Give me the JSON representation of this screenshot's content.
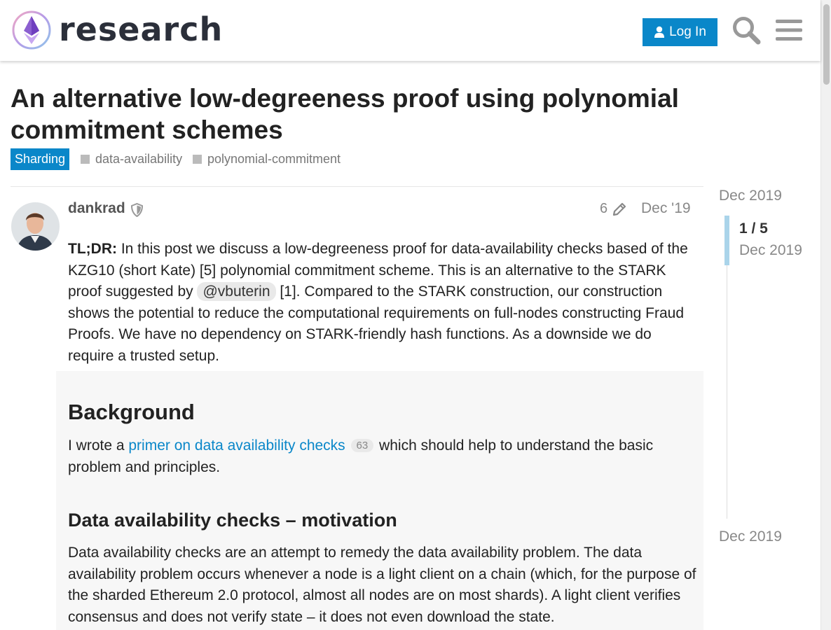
{
  "header": {
    "logo_text": "research",
    "login_label": "Log In",
    "search_icon": "search-icon",
    "menu_icon": "hamburger-menu-icon"
  },
  "topic": {
    "title": "An alternative low-degreeness proof using polynomial commitment schemes",
    "category": "Sharding",
    "tags": [
      "data-availability",
      "polynomial-commitment"
    ]
  },
  "post": {
    "username": "dankrad",
    "edit_count": "6",
    "date": "Dec '19",
    "p1": {
      "lead": "TL;DR:",
      "text_a": " In this post we discuss a low-degreeness proof for data-availability checks based of the KZG10 (short Kate) [5] polynomial commitment scheme. This is an alternative to the STARK proof suggested by ",
      "mention": "@vbuterin",
      "text_b": " [1]. Compared to the STARK construction, our construction shows the potential to reduce the computational requirements on full-nodes constructing Fraud Proofs. We have no dependency on STARK-friendly hash functions. As a downside we do require a trusted setup."
    },
    "h_background": "Background",
    "p2": {
      "text_a": "I wrote a ",
      "link": "primer on data availability checks",
      "clicks": "63",
      "text_b": " which should help to understand the basic problem and principles."
    },
    "h_motivation": "Data availability checks – motivation",
    "p3": "Data availability checks are an attempt to remedy the data availability problem. The data availability problem occurs whenever a node is a light client on a chain (which, for the purpose of the sharded Ethereum 2.0 protocol, almost all nodes are on most shards). A light client verifies consensus and does not verify state – it does not even download the state."
  },
  "timeline": {
    "start_date": "Dec 2019",
    "position": "1 / 5",
    "current_date": "Dec 2019",
    "end_date": "Dec 2019"
  },
  "colors": {
    "accent": "#0a87c9",
    "muted": "#888888",
    "timeline_handle": "#aad4ea"
  }
}
